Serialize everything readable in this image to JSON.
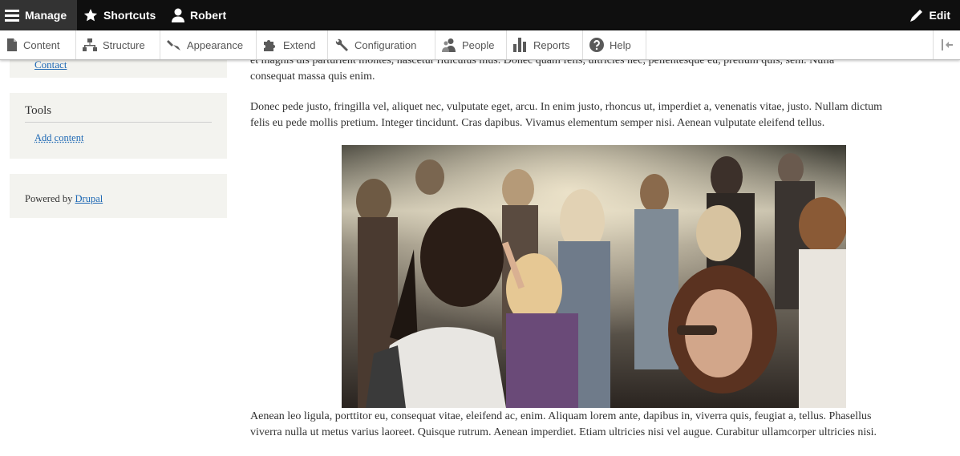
{
  "toolbar": {
    "manage_label": "Manage",
    "shortcuts_label": "Shortcuts",
    "user_label": "Robert",
    "edit_label": "Edit"
  },
  "tray": {
    "items": [
      {
        "label": "Content",
        "icon": "page-icon"
      },
      {
        "label": "Structure",
        "icon": "sitemap-icon"
      },
      {
        "label": "Appearance",
        "icon": "paint-icon"
      },
      {
        "label": "Extend",
        "icon": "puzzle-icon"
      },
      {
        "label": "Configuration",
        "icon": "wrench-icon"
      },
      {
        "label": "People",
        "icon": "people-icon"
      },
      {
        "label": "Reports",
        "icon": "bar-chart-icon"
      },
      {
        "label": "Help",
        "icon": "help-icon"
      }
    ],
    "toggle_icon": "collapse-tray-icon"
  },
  "sidebar": {
    "top_block_link": "Contact",
    "tools": {
      "title": "Tools",
      "link": "Add content"
    },
    "powered": {
      "prefix": "Powered by ",
      "link": "Drupal"
    }
  },
  "main": {
    "paragraphs": [
      {
        "line1": "et magnis dis parturient montes, nascetur ridiculus mus. Donec quam felis, ultricies nec, pellentesque eu, pretium quis, sem. Nulla",
        "line2": "consequat massa quis enim."
      },
      {
        "line1": "Donec pede justo, fringilla vel, aliquet nec, vulputate eget, arcu. In enim justo, rhoncus ut, imperdiet a, venenatis vitae, justo. Nullam dictum",
        "line2": "felis eu pede mollis pretium. Integer tincidunt. Cras dapibus. Vivamus elementum semper nisi. Aenean vulputate eleifend tellus."
      },
      {
        "line1": "Aenean leo ligula, porttitor eu, consequat vitae, eleifend ac, enim. Aliquam lorem ante, dapibus in, viverra quis, feugiat a, tellus. Phasellus",
        "line2": "viverra nulla ut metus varius laoreet. Quisque rutrum. Aenean imperdiet. Etiam ultricies nisi vel augue. Curabitur ullamcorper ultricies nisi."
      }
    ]
  },
  "colors": {
    "toolbar_bg": "#0f0f0f",
    "manage_bg": "#333333",
    "link": "#1e68b4",
    "sidebar_bg": "#f3f3ef"
  }
}
